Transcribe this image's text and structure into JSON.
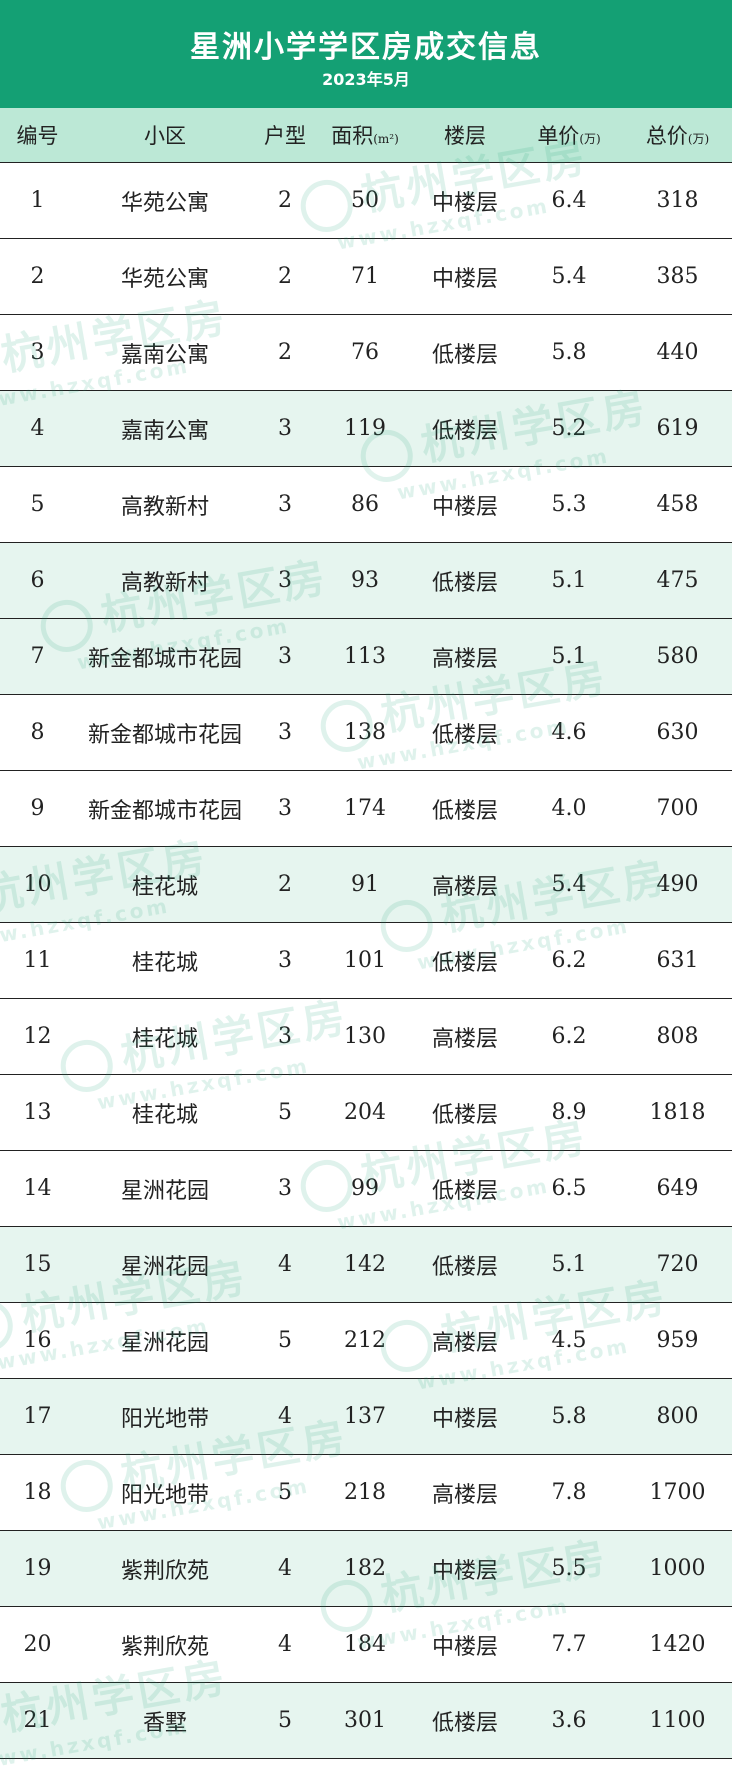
{
  "header": {
    "title": "星洲小学学区房成交信息",
    "subtitle": "2023年5月"
  },
  "columns": {
    "no": "编号",
    "community": "小区",
    "layout": "户型",
    "area": "面积",
    "area_unit": "(m²)",
    "floor": "楼层",
    "unit_price": "单价",
    "unit_price_unit": "(万)",
    "total": "总价",
    "total_unit": "(万)"
  },
  "watermark": {
    "text": "杭州学区房",
    "url": "www.hzxqf.com"
  },
  "colors": {
    "header_bg": "#14a074",
    "colhead_bg": "#bce8d6",
    "alt_row_bg": "#e6f5ef"
  },
  "rows": [
    {
      "no": "1",
      "community": "华苑公寓",
      "layout": "2",
      "area": "50",
      "floor": "中楼层",
      "unit_price": "6.4",
      "total": "318"
    },
    {
      "no": "2",
      "community": "华苑公寓",
      "layout": "2",
      "area": "71",
      "floor": "中楼层",
      "unit_price": "5.4",
      "total": "385"
    },
    {
      "no": "3",
      "community": "嘉南公寓",
      "layout": "2",
      "area": "76",
      "floor": "低楼层",
      "unit_price": "5.8",
      "total": "440"
    },
    {
      "no": "4",
      "community": "嘉南公寓",
      "layout": "3",
      "area": "119",
      "floor": "低楼层",
      "unit_price": "5.2",
      "total": "619"
    },
    {
      "no": "5",
      "community": "高教新村",
      "layout": "3",
      "area": "86",
      "floor": "中楼层",
      "unit_price": "5.3",
      "total": "458"
    },
    {
      "no": "6",
      "community": "高教新村",
      "layout": "3",
      "area": "93",
      "floor": "低楼层",
      "unit_price": "5.1",
      "total": "475"
    },
    {
      "no": "7",
      "community": "新金都城市花园",
      "layout": "3",
      "area": "113",
      "floor": "高楼层",
      "unit_price": "5.1",
      "total": "580"
    },
    {
      "no": "8",
      "community": "新金都城市花园",
      "layout": "3",
      "area": "138",
      "floor": "低楼层",
      "unit_price": "4.6",
      "total": "630"
    },
    {
      "no": "9",
      "community": "新金都城市花园",
      "layout": "3",
      "area": "174",
      "floor": "低楼层",
      "unit_price": "4.0",
      "total": "700"
    },
    {
      "no": "10",
      "community": "桂花城",
      "layout": "2",
      "area": "91",
      "floor": "高楼层",
      "unit_price": "5.4",
      "total": "490"
    },
    {
      "no": "11",
      "community": "桂花城",
      "layout": "3",
      "area": "101",
      "floor": "低楼层",
      "unit_price": "6.2",
      "total": "631"
    },
    {
      "no": "12",
      "community": "桂花城",
      "layout": "3",
      "area": "130",
      "floor": "高楼层",
      "unit_price": "6.2",
      "total": "808"
    },
    {
      "no": "13",
      "community": "桂花城",
      "layout": "5",
      "area": "204",
      "floor": "低楼层",
      "unit_price": "8.9",
      "total": "1818"
    },
    {
      "no": "14",
      "community": "星洲花园",
      "layout": "3",
      "area": "99",
      "floor": "低楼层",
      "unit_price": "6.5",
      "total": "649"
    },
    {
      "no": "15",
      "community": "星洲花园",
      "layout": "4",
      "area": "142",
      "floor": "低楼层",
      "unit_price": "5.1",
      "total": "720"
    },
    {
      "no": "16",
      "community": "星洲花园",
      "layout": "5",
      "area": "212",
      "floor": "高楼层",
      "unit_price": "4.5",
      "total": "959"
    },
    {
      "no": "17",
      "community": "阳光地带",
      "layout": "4",
      "area": "137",
      "floor": "中楼层",
      "unit_price": "5.8",
      "total": "800"
    },
    {
      "no": "18",
      "community": "阳光地带",
      "layout": "5",
      "area": "218",
      "floor": "高楼层",
      "unit_price": "7.8",
      "total": "1700"
    },
    {
      "no": "19",
      "community": "紫荆欣苑",
      "layout": "4",
      "area": "182",
      "floor": "中楼层",
      "unit_price": "5.5",
      "total": "1000"
    },
    {
      "no": "20",
      "community": "紫荆欣苑",
      "layout": "4",
      "area": "184",
      "floor": "中楼层",
      "unit_price": "7.7",
      "total": "1420"
    },
    {
      "no": "21",
      "community": "香墅",
      "layout": "5",
      "area": "301",
      "floor": "低楼层",
      "unit_price": "3.6",
      "total": "1100"
    }
  ]
}
